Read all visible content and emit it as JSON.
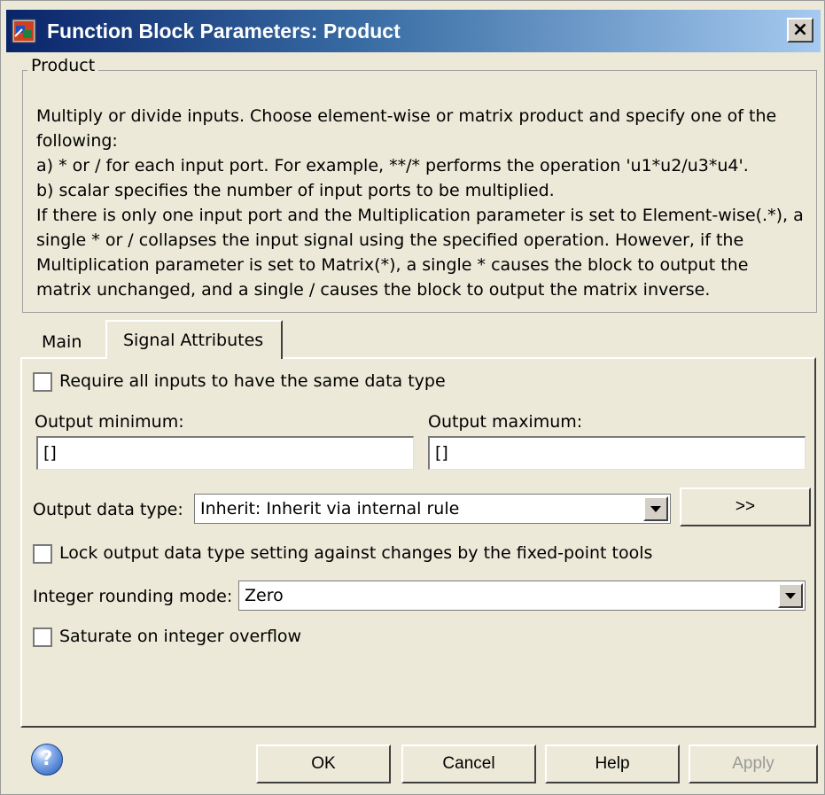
{
  "window": {
    "title": "Function Block Parameters: Product",
    "close_glyph": "×"
  },
  "group": {
    "label": "Product",
    "description": "Multiply or divide inputs.  Choose element-wise or matrix product and specify one of the following:\n a) * or / for each input port. For example, **/* performs the operation 'u1*u2/u3*u4'.\n b) scalar specifies the number of input ports to be multiplied.\nIf there is only one input port and the Multiplication parameter is set to Element-wise(.*), a single * or / collapses the input signal using the specified operation. However, if the Multiplication parameter is set to Matrix(*), a single * causes the block to output the matrix unchanged, and a single / causes the block to output the matrix inverse."
  },
  "tabs": [
    {
      "label": "Main",
      "selected": false
    },
    {
      "label": "Signal Attributes",
      "selected": true
    }
  ],
  "signal_attributes": {
    "require_same_type_label": "Require all inputs to have the same data type",
    "require_same_type_checked": false,
    "output_min_label": "Output minimum:",
    "output_min_value": "[]",
    "output_max_label": "Output maximum:",
    "output_max_value": "[]",
    "output_data_type_label": "Output data type:",
    "output_data_type_value": "Inherit: Inherit via internal rule",
    "data_type_assistant_label": ">>",
    "lock_output_label": "Lock output data type setting against changes by the fixed-point tools",
    "lock_output_checked": false,
    "rounding_mode_label": "Integer rounding mode:",
    "rounding_mode_value": "Zero",
    "saturate_label": "Saturate on integer overflow",
    "saturate_checked": false
  },
  "buttons": {
    "help_icon_glyph": "?",
    "ok": "OK",
    "cancel": "Cancel",
    "help": "Help",
    "apply": "Apply"
  },
  "colors": {
    "titlebar_start": "#0a246a",
    "titlebar_end": "#a6caf0",
    "dialog_bg": "#ece9d8"
  }
}
